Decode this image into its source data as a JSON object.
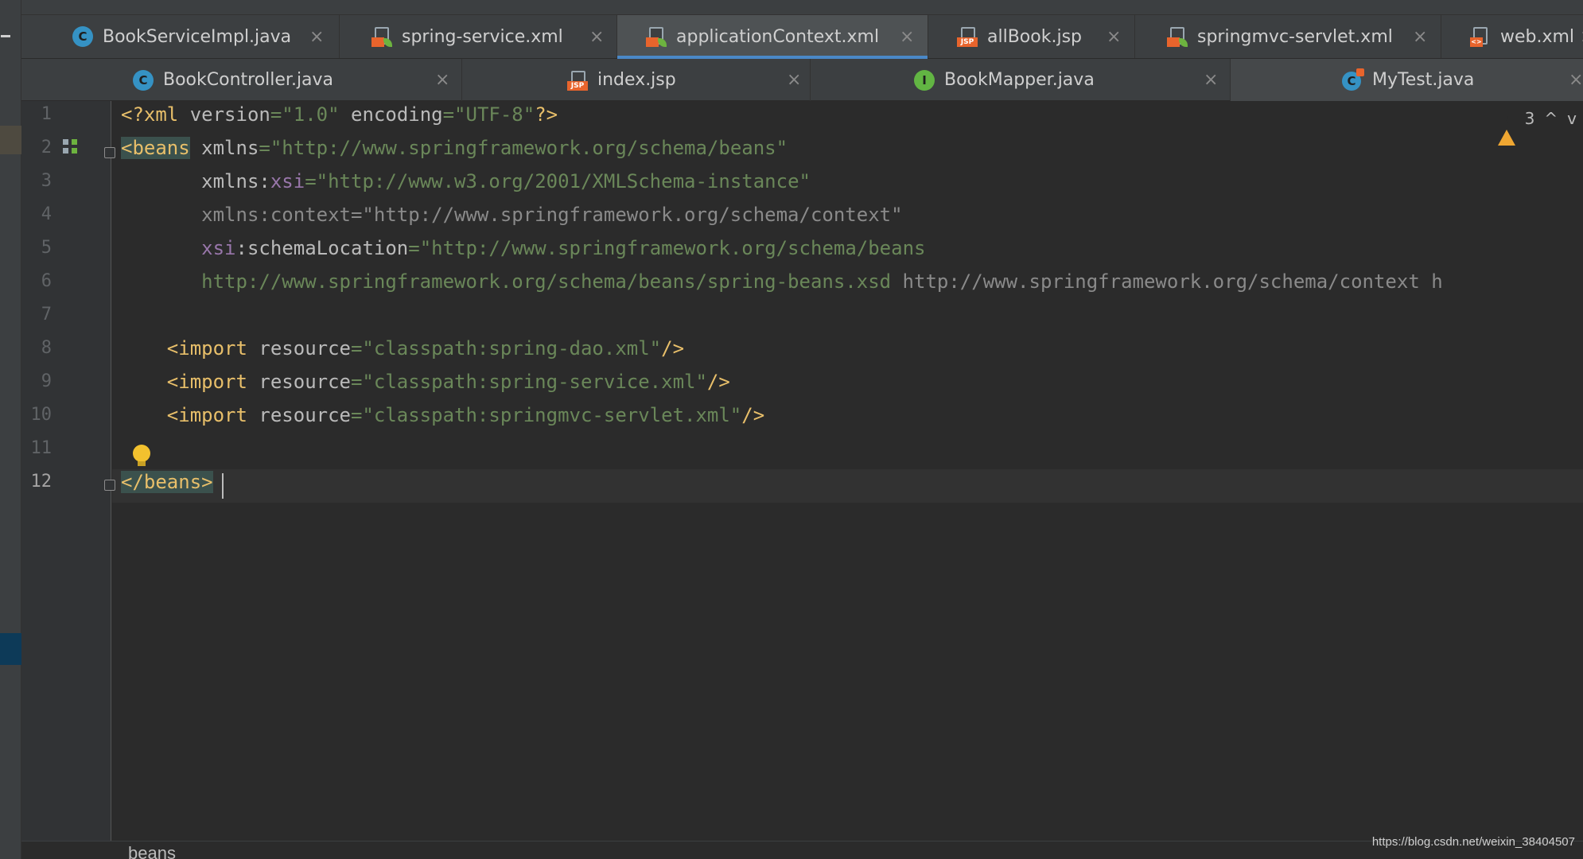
{
  "tabs_row1": [
    {
      "label": "BookServiceImpl.java",
      "icon": "class-icon",
      "active": false
    },
    {
      "label": "spring-service.xml",
      "icon": "spring-xml-icon",
      "active": false
    },
    {
      "label": "applicationContext.xml",
      "icon": "spring-xml-icon",
      "active": true
    },
    {
      "label": "allBook.jsp",
      "icon": "jsp-icon",
      "active": false
    },
    {
      "label": "springmvc-servlet.xml",
      "icon": "spring-xml-icon",
      "active": false
    },
    {
      "label": "web.xml",
      "icon": "xml-icon",
      "active": false
    }
  ],
  "tabs_row2": [
    {
      "label": "BookController.java",
      "icon": "class-icon"
    },
    {
      "label": "index.jsp",
      "icon": "jsp-icon"
    },
    {
      "label": "BookMapper.java",
      "icon": "interface-icon"
    },
    {
      "label": "MyTest.java",
      "icon": "test-class-icon"
    }
  ],
  "icon_letters": {
    "class": "C",
    "interface": "I",
    "jsp": "JSP",
    "xml": "<>"
  },
  "close_glyph": "×",
  "editor": {
    "line_numbers": [
      "1",
      "2",
      "3",
      "4",
      "5",
      "6",
      "7",
      "8",
      "9",
      "10",
      "11",
      "12"
    ],
    "current_line": "12",
    "lines": [
      [
        {
          "t": "<?xml ",
          "c": "tag"
        },
        {
          "t": "version",
          "c": "attr"
        },
        {
          "t": "=\"1.0\" ",
          "c": "str"
        },
        {
          "t": "encoding",
          "c": "attr"
        },
        {
          "t": "=\"UTF-8\"",
          "c": "str"
        },
        {
          "t": "?>",
          "c": "tag"
        }
      ],
      [
        {
          "t": "<beans",
          "c": "tag-hl"
        },
        {
          "t": " xmlns",
          "c": "attr"
        },
        {
          "t": "=\"http://www.springframework.org/schema/beans\"",
          "c": "str"
        }
      ],
      [
        {
          "t": "       xmlns:",
          "c": "attr"
        },
        {
          "t": "xsi",
          "c": "ns"
        },
        {
          "t": "=\"http://www.w3.org/2001/XMLSchema-instance\"",
          "c": "str"
        }
      ],
      [
        {
          "t": "       xmlns:context=\"http://www.springframework.org/schema/context\"",
          "c": "gray"
        }
      ],
      [
        {
          "t": "       ",
          "c": "attr"
        },
        {
          "t": "xsi",
          "c": "ns"
        },
        {
          "t": ":schemaLocation",
          "c": "attr"
        },
        {
          "t": "=\"http://www.springframework.org/schema/beans",
          "c": "str"
        }
      ],
      [
        {
          "t": "       http://www.springframework.org/schema/beans/spring-beans.xsd ",
          "c": "str"
        },
        {
          "t": "http://www.springframework.org/schema/context h",
          "c": "gray"
        }
      ],
      [],
      [
        {
          "t": "    <import ",
          "c": "tag"
        },
        {
          "t": "resource",
          "c": "attr"
        },
        {
          "t": "=\"classpath:spring-dao.xml\"",
          "c": "str"
        },
        {
          "t": "/>",
          "c": "tag"
        }
      ],
      [
        {
          "t": "    <import ",
          "c": "tag"
        },
        {
          "t": "resource",
          "c": "attr"
        },
        {
          "t": "=\"classpath:spring-service.xml\"",
          "c": "str"
        },
        {
          "t": "/>",
          "c": "tag"
        }
      ],
      [
        {
          "t": "    <import ",
          "c": "tag"
        },
        {
          "t": "resource",
          "c": "attr"
        },
        {
          "t": "=\"classpath:springmvc-servlet.xml\"",
          "c": "str"
        },
        {
          "t": "/>",
          "c": "tag"
        }
      ],
      [],
      [
        {
          "t": "</beans>",
          "c": "tag-hl"
        }
      ]
    ]
  },
  "inspection": {
    "warning_count": "3",
    "up_glyph": "^",
    "down_glyph": "v"
  },
  "breadcrumb": {
    "item": "beans"
  },
  "watermark": "https://blog.csdn.net/weixin_38404507",
  "colors": {
    "tag": "#e8bf6a",
    "attr": "#bababa",
    "namespace": "#9876aa",
    "string": "#6a8759",
    "active_tab_underline": "#4a88c7",
    "warning": "#f0a732"
  }
}
